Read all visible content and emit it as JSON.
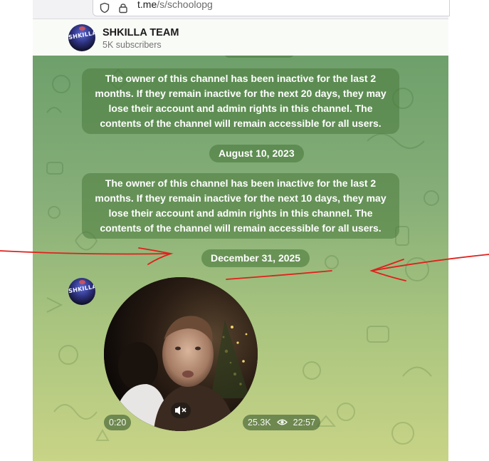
{
  "browser": {
    "url_host": "t.me",
    "url_path": "/s/schoolopg"
  },
  "channel": {
    "name": "SHKILLA TEAM",
    "subscribers": "5K subscribers",
    "avatar_text": "SHKILLA TEAM"
  },
  "messages": {
    "service_1": "The owner of this channel has been inactive for the last 2 months. If they remain inactive for the next 20 days, they may lose their account and admin rights in this channel. The contents of the channel will remain accessible for all users.",
    "date_1": "August 10, 2023",
    "service_2": "The owner of this channel has been inactive for the last 2 months. If they remain inactive for the next 10 days, they may lose their account and admin rights in this channel. The contents of the channel will remain accessible for all users.",
    "date_2": "December 31, 2025"
  },
  "video_message": {
    "duration": "0:20",
    "views": "25.3K",
    "time": "22:57",
    "muted": true
  },
  "icons": {
    "url_bar": [
      "shield-icon",
      "lock-icon"
    ],
    "views": "eye-icon",
    "sound": "mute-icon"
  },
  "colors": {
    "service_bg": "#4a7a3c",
    "chat_top": "#6ea06b",
    "chat_bottom": "#c8d486",
    "annotation": "#e0201c"
  }
}
